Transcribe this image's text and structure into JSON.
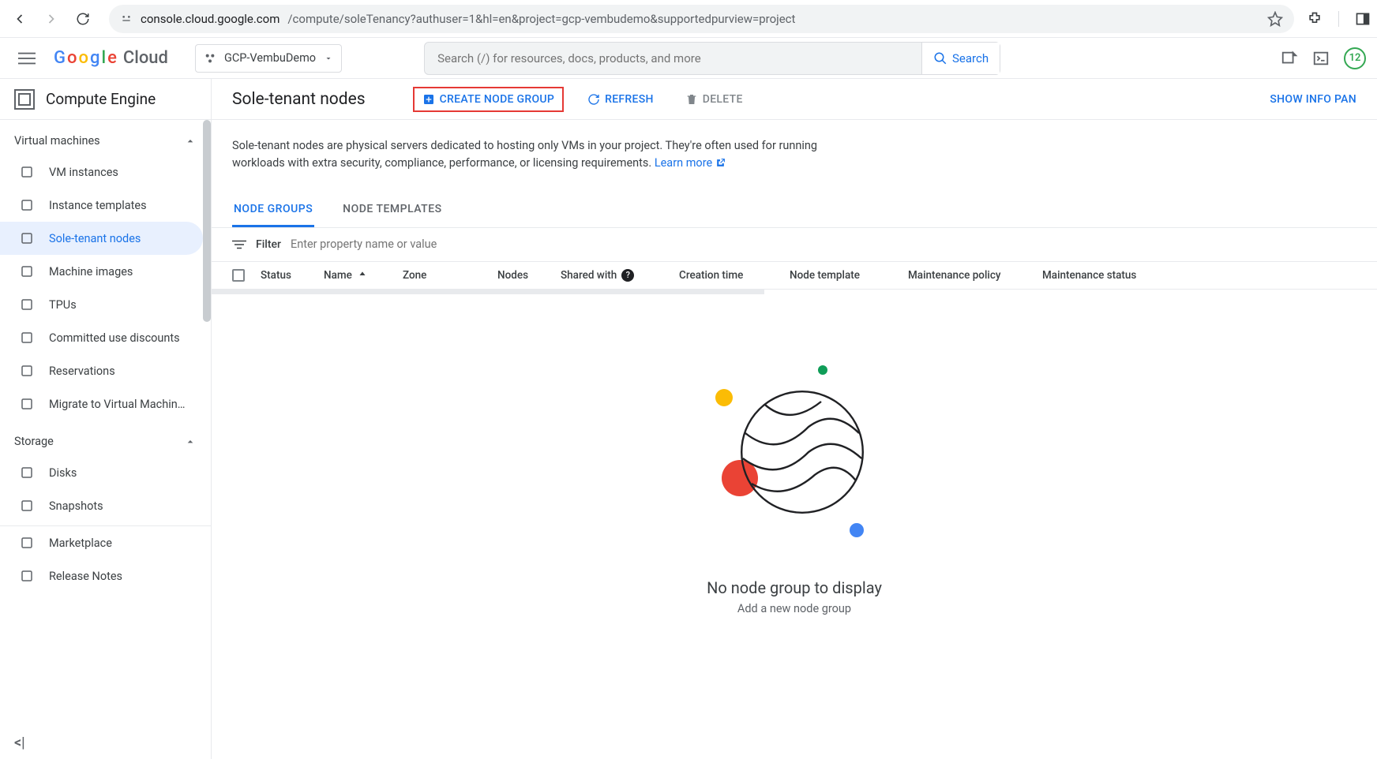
{
  "browser": {
    "url_host": "console.cloud.google.com",
    "url_path": "/compute/soleTenancy?authuser=1&hl=en&project=gcp-vembudemo&supportedpurview=project"
  },
  "header": {
    "logo_text": "Google",
    "logo_suffix": "Cloud",
    "project_name": "GCP-VembuDemo",
    "search_placeholder": "Search (/) for resources, docs, products, and more",
    "search_button": "Search",
    "notif_count": "12"
  },
  "sidebar": {
    "product": "Compute Engine",
    "section_vm": "Virtual machines",
    "items_vm": [
      {
        "label": "VM instances"
      },
      {
        "label": "Instance templates"
      },
      {
        "label": "Sole-tenant nodes",
        "active": true
      },
      {
        "label": "Machine images"
      },
      {
        "label": "TPUs"
      },
      {
        "label": "Committed use discounts"
      },
      {
        "label": "Reservations"
      },
      {
        "label": "Migrate to Virtual Machin…"
      }
    ],
    "section_storage": "Storage",
    "items_storage": [
      {
        "label": "Disks"
      },
      {
        "label": "Snapshots"
      }
    ],
    "items_other": [
      {
        "label": "Marketplace"
      },
      {
        "label": "Release Notes"
      }
    ]
  },
  "page": {
    "title": "Sole-tenant nodes",
    "create_btn": "CREATE NODE GROUP",
    "refresh_btn": "REFRESH",
    "delete_btn": "DELETE",
    "info_panel": "SHOW INFO PAN",
    "description": "Sole-tenant nodes are physical servers dedicated to hosting only VMs in your project. They're often used for running workloads with extra security, compliance, performance, or licensing requirements.",
    "learn_more": "Learn more",
    "tabs": [
      {
        "label": "NODE GROUPS",
        "active": true
      },
      {
        "label": "NODE TEMPLATES"
      }
    ],
    "filter_label": "Filter",
    "filter_placeholder": "Enter property name or value",
    "columns": [
      "Status",
      "Name",
      "Zone",
      "Nodes",
      "Shared with",
      "Creation time",
      "Node template",
      "Maintenance policy",
      "Maintenance status"
    ],
    "sort_column": "Name",
    "sort_dir": "asc",
    "rows": [],
    "empty_title": "No node group to display",
    "empty_sub": "Add a new node group"
  }
}
